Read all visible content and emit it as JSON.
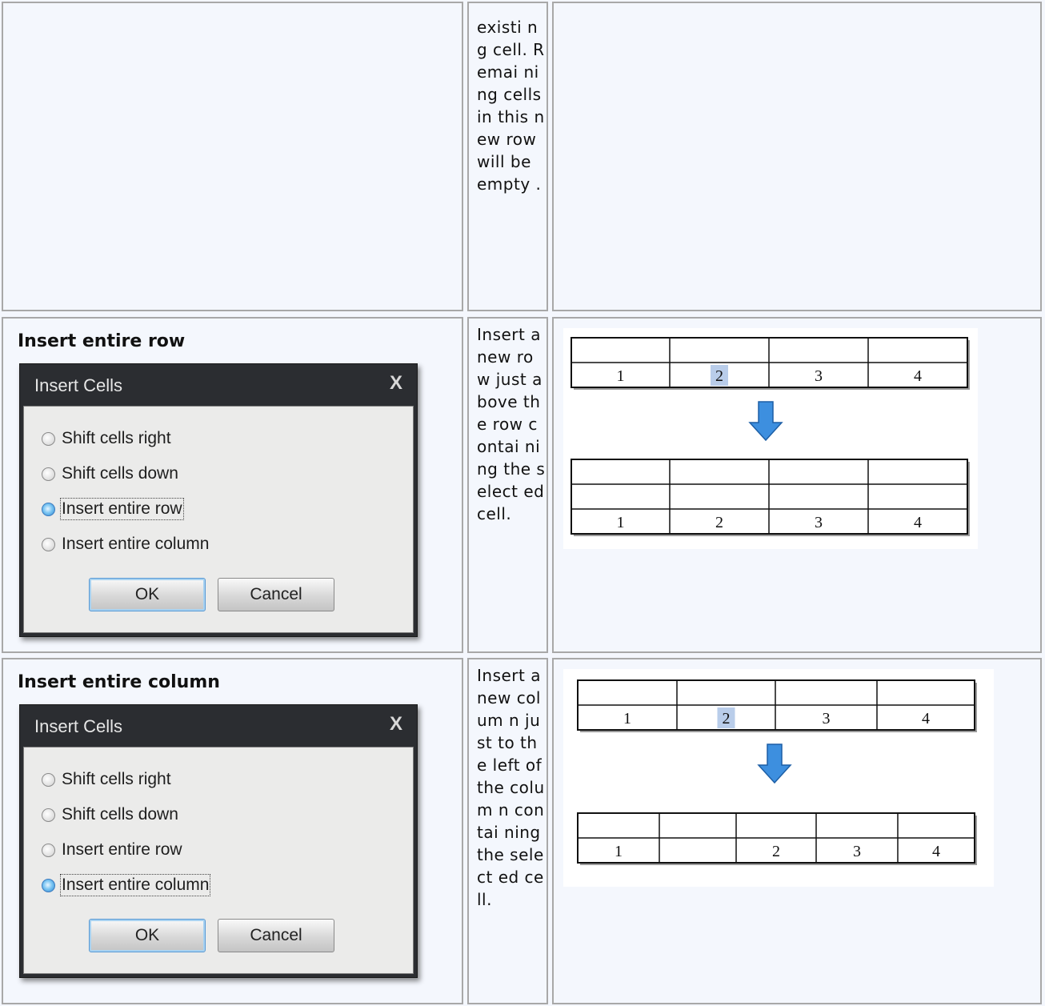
{
  "rows": [
    {
      "description": "existi ng cell. Remai ning cells in this new row will be empty ."
    },
    {
      "heading": "Insert entire row",
      "dialog": {
        "title": "Insert Cells",
        "close": "X",
        "options": [
          "Shift cells right",
          "Shift cells down",
          "Insert entire row",
          "Insert entire column"
        ],
        "selected": "Insert entire row",
        "ok": "OK",
        "cancel": "Cancel"
      },
      "description": "Insert a new row just above the row contai ning the select ed cell.",
      "diagram": {
        "before": {
          "cols": 4,
          "rows": [
            [
              "",
              "",
              "",
              ""
            ],
            [
              "1",
              "2",
              "3",
              "4"
            ]
          ],
          "highlight": "2"
        },
        "after": {
          "cols": 4,
          "rows": [
            [
              "",
              "",
              "",
              ""
            ],
            [
              "",
              "",
              "",
              ""
            ],
            [
              "1",
              "2",
              "3",
              "4"
            ]
          ]
        }
      }
    },
    {
      "heading": "Insert entire column",
      "dialog": {
        "title": "Insert Cells",
        "close": "X",
        "options": [
          "Shift cells right",
          "Shift cells down",
          "Insert entire row",
          "Insert entire column"
        ],
        "selected": "Insert entire column",
        "ok": "OK",
        "cancel": "Cancel"
      },
      "description": "Insert a new colum n just to the left of the colum n contai ning the select ed cell.",
      "diagram": {
        "before": {
          "cols": 4,
          "rows": [
            [
              "",
              "",
              "",
              ""
            ],
            [
              "1",
              "2",
              "3",
              "4"
            ]
          ],
          "highlight": "2"
        },
        "after": {
          "cols": 5,
          "rows": [
            [
              "",
              "",
              "",
              "",
              ""
            ],
            [
              "1",
              "",
              "2",
              "3",
              "4"
            ]
          ]
        }
      }
    }
  ],
  "colors": {
    "page": "#f4f7fd",
    "border": "#a8a8a8",
    "dialog_title_bar": "#2b2d31",
    "arrow": "#3d8fdf",
    "highlight": "#b9cdea"
  }
}
